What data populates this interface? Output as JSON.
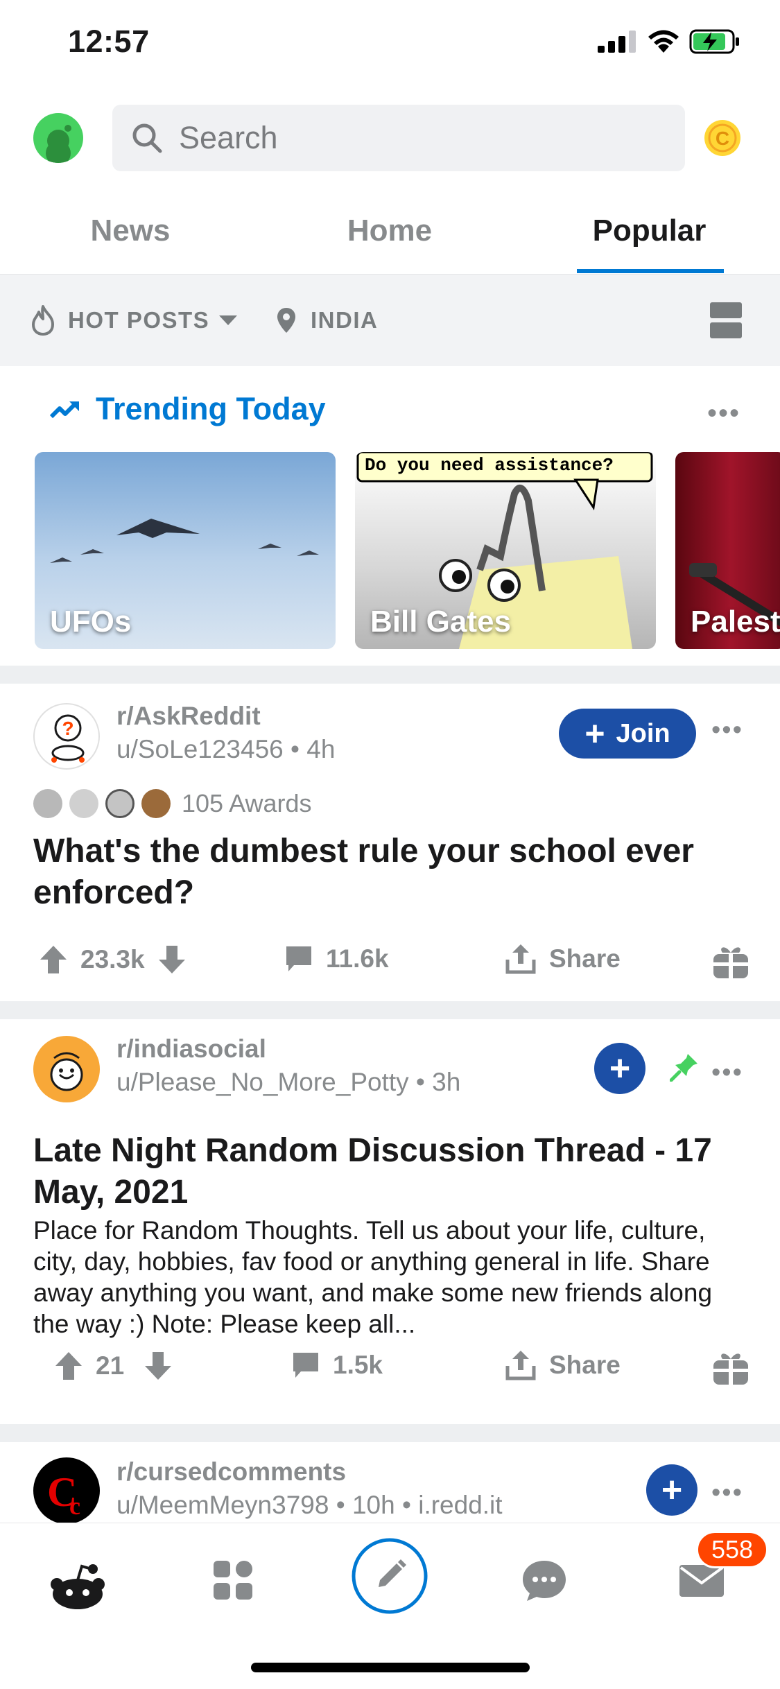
{
  "status_bar": {
    "time": "12:57"
  },
  "header": {
    "search_placeholder": "Search"
  },
  "tabs": [
    {
      "label": "News",
      "active": false
    },
    {
      "label": "Home",
      "active": false
    },
    {
      "label": "Popular",
      "active": true
    }
  ],
  "sort_bar": {
    "sort_label": "HOT POSTS",
    "location_label": "INDIA"
  },
  "trending": {
    "title": "Trending Today",
    "cards": [
      {
        "label": "UFOs"
      },
      {
        "label": "Bill Gates",
        "caption": "Do you need assistance?"
      },
      {
        "label": "Palest"
      }
    ]
  },
  "posts": [
    {
      "subreddit": "r/AskReddit",
      "author": "u/SoLe123456",
      "age": "4h",
      "join_label": "Join",
      "awards_count": "105 Awards",
      "title": "What's the dumbest rule your school ever enforced?",
      "upvotes": "23.3k",
      "comments": "11.6k",
      "share_label": "Share"
    },
    {
      "subreddit": "r/indiasocial",
      "author": "u/Please_No_More_Potty",
      "age": "3h",
      "title": "Late Night Random Discussion Thread - 17 May, 2021",
      "body": "Place for Random Thoughts. Tell us about your life, culture, city, day, hobbies, fav food or anything general in life. Share away anything you want, and make some new friends along the way :) Note: Please keep all...",
      "upvotes": "21",
      "comments": "1.5k",
      "share_label": "Share"
    },
    {
      "subreddit": "r/cursedcomments",
      "author": "u/MeemMeyn3798",
      "age": "10h",
      "domain": "i.redd.it"
    }
  ],
  "bottom_nav": {
    "inbox_badge": "558"
  },
  "colors": {
    "accent": "#0079d3",
    "join": "#1c4fa6",
    "badge": "#ff4500",
    "muted": "#878a8c"
  }
}
